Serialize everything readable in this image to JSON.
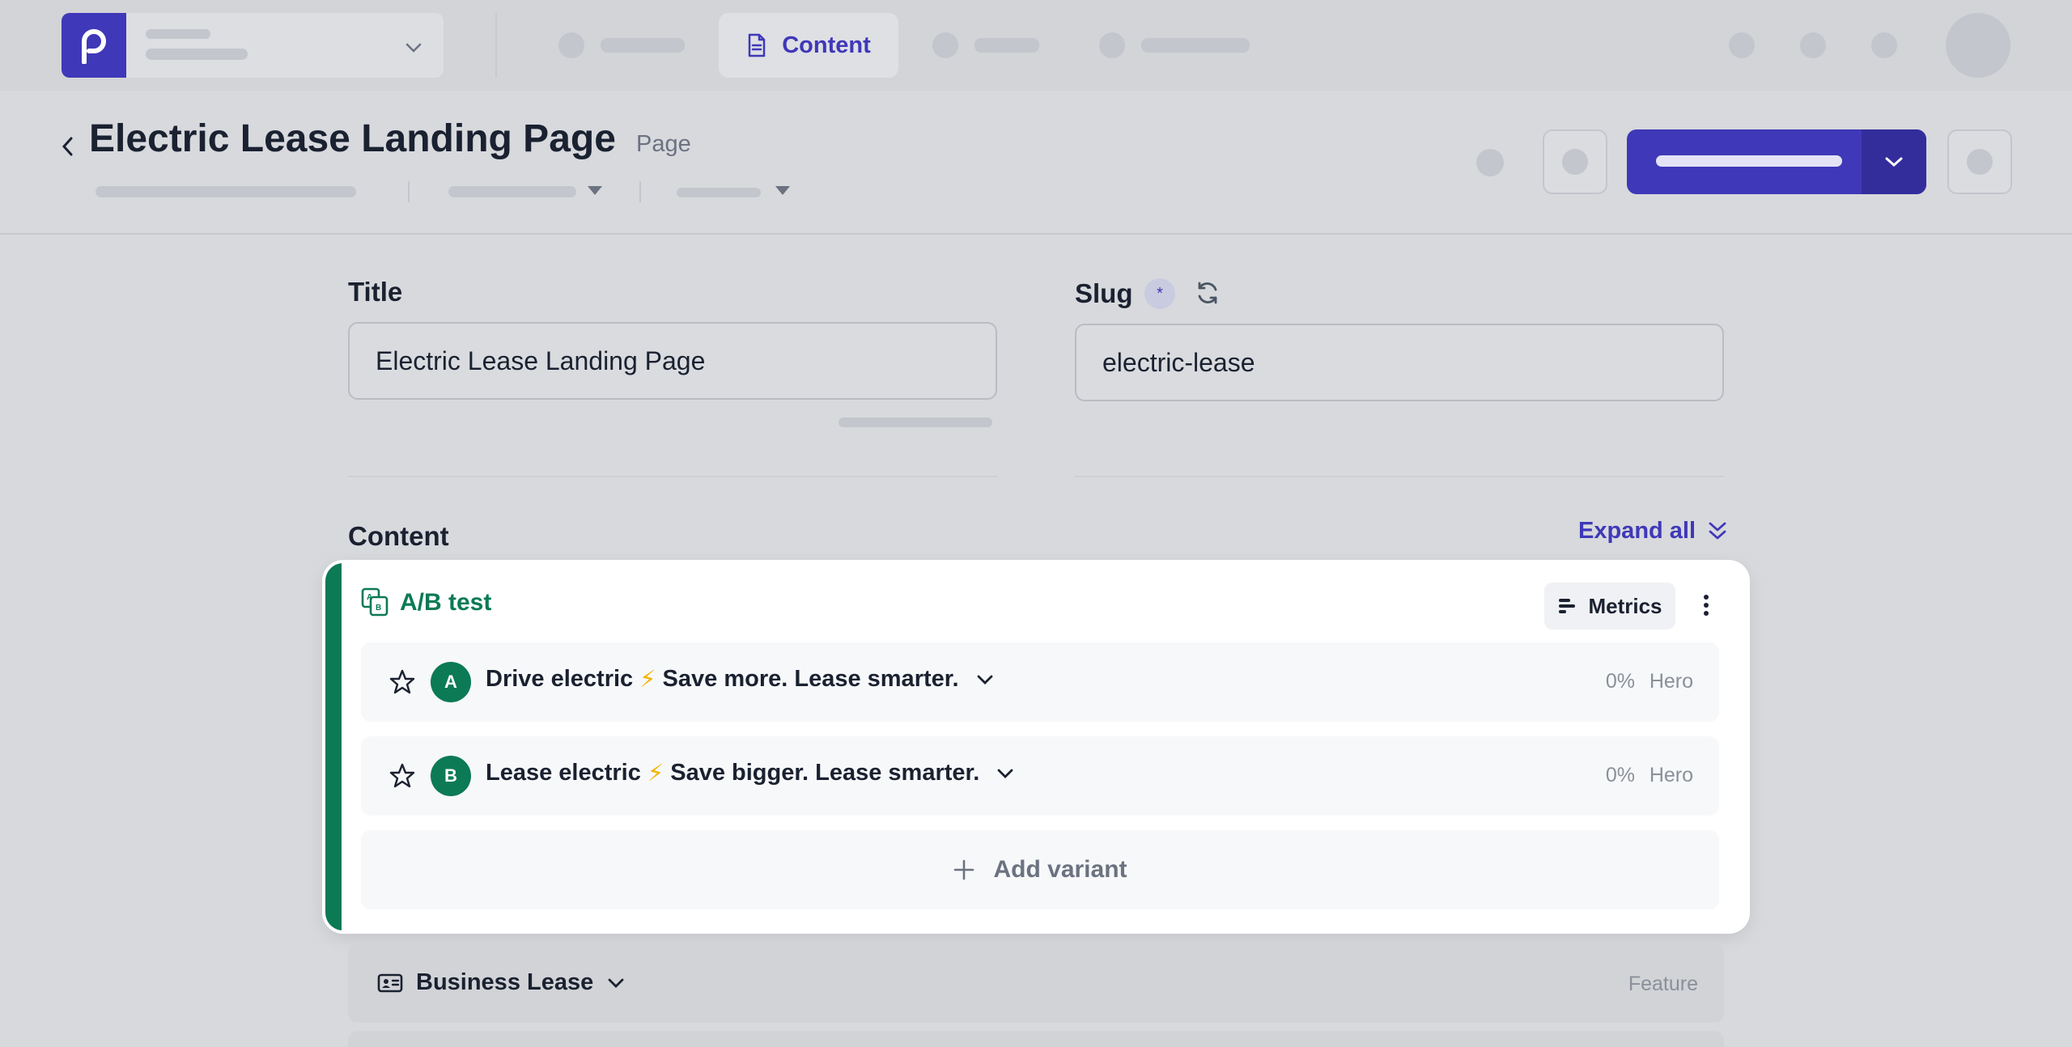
{
  "nav": {
    "active_tab": "Content"
  },
  "header": {
    "title": "Electric Lease Landing Page",
    "kind": "Page"
  },
  "form": {
    "title_label": "Title",
    "title_value": "Electric Lease Landing Page",
    "slug_label": "Slug",
    "slug_required_marker": "*",
    "slug_value": "electric-lease"
  },
  "content": {
    "label": "Content",
    "expand_all": "Expand all",
    "ab_test": {
      "title": "A/B test",
      "metrics_label": "Metrics",
      "variants": [
        {
          "letter": "A",
          "title_a": "Drive electric",
          "bolt": "⚡",
          "title_b": "Save more. Lease smarter.",
          "percent": "0%",
          "kind": "Hero"
        },
        {
          "letter": "B",
          "title_a": "Lease electric",
          "bolt": "⚡",
          "title_b": "Save bigger. Lease smarter.",
          "percent": "0%",
          "kind": "Hero"
        }
      ],
      "add_variant": "Add variant"
    },
    "blocks": [
      {
        "title": "Business Lease",
        "kind": "Feature"
      }
    ]
  },
  "colors": {
    "brand": "#3f38b8",
    "ab_green": "#0b7a55",
    "bolt": "#f3b400"
  }
}
